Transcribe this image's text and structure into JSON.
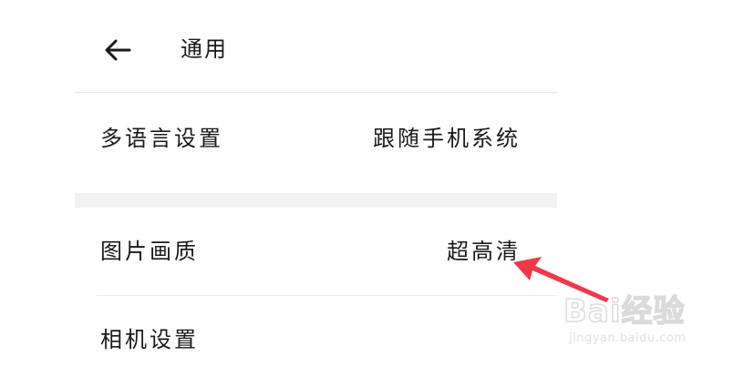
{
  "header": {
    "title": "通用",
    "back_icon": "arrow-left-icon"
  },
  "settings": {
    "language_label": "多语言设置",
    "language_value": "跟随手机系统",
    "image_quality_label": "图片画质",
    "image_quality_value": "超高清",
    "camera_label": "相机设置"
  },
  "annotation": {
    "arrow_color": "#f0384a",
    "points_to": "image_quality_value"
  },
  "watermark": {
    "logo_text": "Bai经验",
    "url": "jingyan.baidu.com"
  },
  "colors": {
    "divider": "#e6e6e6",
    "section_gap": "#f2f2f2",
    "arrow": "#f0384a"
  }
}
